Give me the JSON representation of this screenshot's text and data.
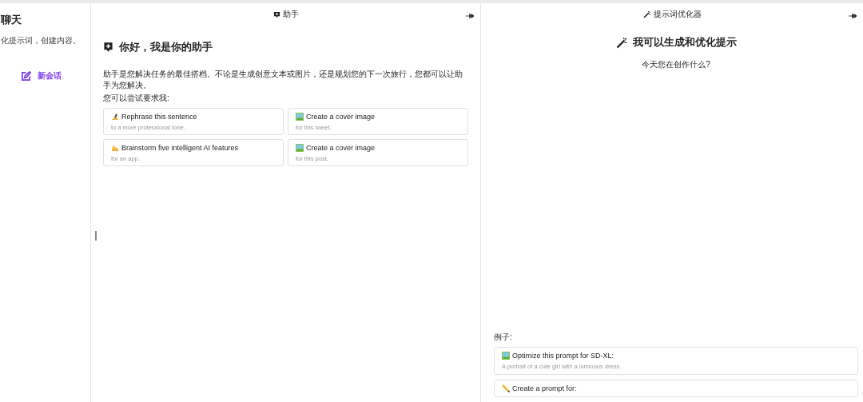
{
  "sidebar": {
    "title": "聊天",
    "subtitle": "化提示词，创建内容。",
    "new_chat": "新会话"
  },
  "assistant": {
    "header": "助手",
    "greeting": "你好，我是你的助手",
    "intro": "助手是您解决任务的最佳搭档。不论是生成创意文本或图片，还是规划您的下一次旅行，您都可以让助手为您解决。",
    "prompt": "您可以尝试要求我:",
    "suggestions": [
      {
        "kind": "write",
        "title": "Rephrase this sentence",
        "subtitle": "to a more professional tone."
      },
      {
        "kind": "image",
        "title": "Create a cover image",
        "subtitle": "for this tweet."
      },
      {
        "kind": "muscle",
        "title": "Brainstorm five intelligent AI features",
        "subtitle": "for an app."
      },
      {
        "kind": "image",
        "title": "Create a cover image",
        "subtitle": "for this post."
      }
    ]
  },
  "optimizer": {
    "header": "提示词优化器",
    "heading": "我可以生成和优化提示",
    "question": "今天您在创作什么?",
    "examples_label": "例子:",
    "examples": [
      {
        "kind": "image",
        "title": "Optimize this prompt for SD-XL:",
        "subtitle": "A portrait of a cute girl with a luminous dress."
      },
      {
        "kind": "pencil",
        "title": "Create a prompt for:"
      }
    ]
  }
}
